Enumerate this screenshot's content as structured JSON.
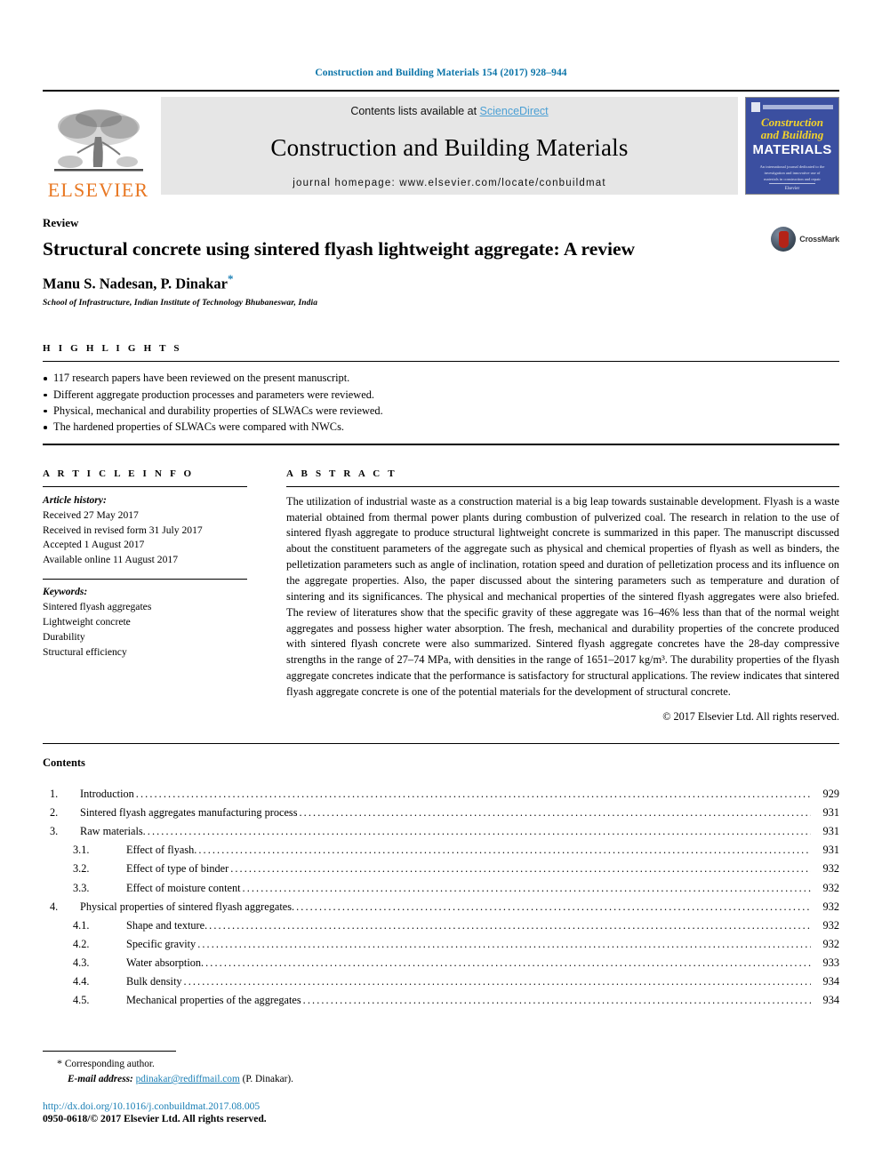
{
  "running_head": "Construction and Building Materials 154 (2017) 928–944",
  "masthead": {
    "publisher_name": "ELSEVIER",
    "contents_prefix": "Contents lists available at ",
    "sciencedirect": "ScienceDirect",
    "journal_title": "Construction and Building Materials",
    "homepage": "journal homepage: www.elsevier.com/locate/conbuildmat",
    "cover": {
      "line1": "Construction",
      "line2": "and Building",
      "line3": "MATERIALS",
      "blurb": "An international journal dedicated to the investigation and innovative use of materials in construction and repair",
      "footer": "Elsevier"
    },
    "link_color": "#4a9fd4"
  },
  "article": {
    "doctype": "Review",
    "title": "Structural concrete using sintered flyash lightweight aggregate: A review",
    "authors": "Manu S. Nadesan, P. Dinakar",
    "corresponding_marker": "*",
    "affiliation": "School of Infrastructure, Indian Institute of Technology Bhubaneswar, India",
    "crossmark_label": "CrossMark"
  },
  "highlights": {
    "heading": "H I G H L I G H T S",
    "items": [
      "117 research papers have been reviewed on the present manuscript.",
      "Different aggregate production processes and parameters were reviewed.",
      "Physical, mechanical and durability properties of SLWACs were reviewed.",
      "The hardened properties of SLWACs were compared with NWCs."
    ]
  },
  "article_info": {
    "heading": "A R T I C L E     I N F O",
    "history_label": "Article history:",
    "history": [
      "Received 27 May 2017",
      "Received in revised form 31 July 2017",
      "Accepted 1 August 2017",
      "Available online 11 August 2017"
    ],
    "keywords_label": "Keywords:",
    "keywords": [
      "Sintered flyash aggregates",
      "Lightweight concrete",
      "Durability",
      "Structural efficiency"
    ]
  },
  "abstract": {
    "heading": "A B S T R A C T",
    "text": "The utilization of industrial waste as a construction material is a big leap towards sustainable development. Flyash is a waste material obtained from thermal power plants during combustion of pulverized coal. The research in relation to the use of sintered flyash aggregate to produce structural lightweight concrete is summarized in this paper. The manuscript discussed about the constituent parameters of the aggregate such as physical and chemical properties of flyash as well as binders, the pelletization parameters such as angle of inclination, rotation speed and duration of pelletization process and its influence on the aggregate properties. Also, the paper discussed about the sintering parameters such as temperature and duration of sintering and its significances. The physical and mechanical properties of the sintered flyash aggregates were also briefed. The review of literatures show that the specific gravity of these aggregate was 16–46% less than that of the normal weight aggregates and possess higher water absorption. The fresh, mechanical and durability properties of the concrete produced with sintered flyash concrete were also summarized. Sintered flyash aggregate concretes have the 28-day compressive strengths in the range of 27–74 MPa, with densities in the range of 1651–2017 kg/m³. The durability properties of the flyash aggregate concretes indicate that the performance is satisfactory for structural applications. The review indicates that sintered flyash aggregate concrete is one of the potential materials for the development of structural concrete.",
    "copyright": "© 2017 Elsevier Ltd. All rights reserved."
  },
  "contents": {
    "heading": "Contents",
    "entries": [
      {
        "level": 1,
        "number": "1.",
        "label": "Introduction",
        "page": "929"
      },
      {
        "level": 1,
        "number": "2.",
        "label": "Sintered flyash aggregates manufacturing process",
        "page": "931"
      },
      {
        "level": 1,
        "number": "3.",
        "label": "Raw materials.",
        "page": "931"
      },
      {
        "level": 2,
        "number": "3.1.",
        "label": "Effect of flyash.",
        "page": "931"
      },
      {
        "level": 2,
        "number": "3.2.",
        "label": "Effect of type of binder",
        "page": "932"
      },
      {
        "level": 2,
        "number": "3.3.",
        "label": "Effect of moisture content",
        "page": "932"
      },
      {
        "level": 1,
        "number": "4.",
        "label": "Physical properties of sintered flyash aggregates.",
        "page": "932"
      },
      {
        "level": 2,
        "number": "4.1.",
        "label": "Shape and texture.",
        "page": "932"
      },
      {
        "level": 2,
        "number": "4.2.",
        "label": "Specific gravity",
        "page": "932"
      },
      {
        "level": 2,
        "number": "4.3.",
        "label": "Water absorption.",
        "page": "933"
      },
      {
        "level": 2,
        "number": "4.4.",
        "label": "Bulk density",
        "page": "934"
      },
      {
        "level": 2,
        "number": "4.5.",
        "label": "Mechanical properties of the aggregates",
        "page": "934"
      }
    ]
  },
  "footer": {
    "corresponding_marker": "*",
    "corresponding_text": "Corresponding author.",
    "email_label": "E-mail address:",
    "email": "pdinakar@rediffmail.com",
    "email_owner": "(P. Dinakar).",
    "doi": "http://dx.doi.org/10.1016/j.conbuildmat.2017.08.005",
    "issn_line": "0950-0618/© 2017 Elsevier Ltd. All rights reserved.",
    "link_color": "#1a7fb5"
  }
}
